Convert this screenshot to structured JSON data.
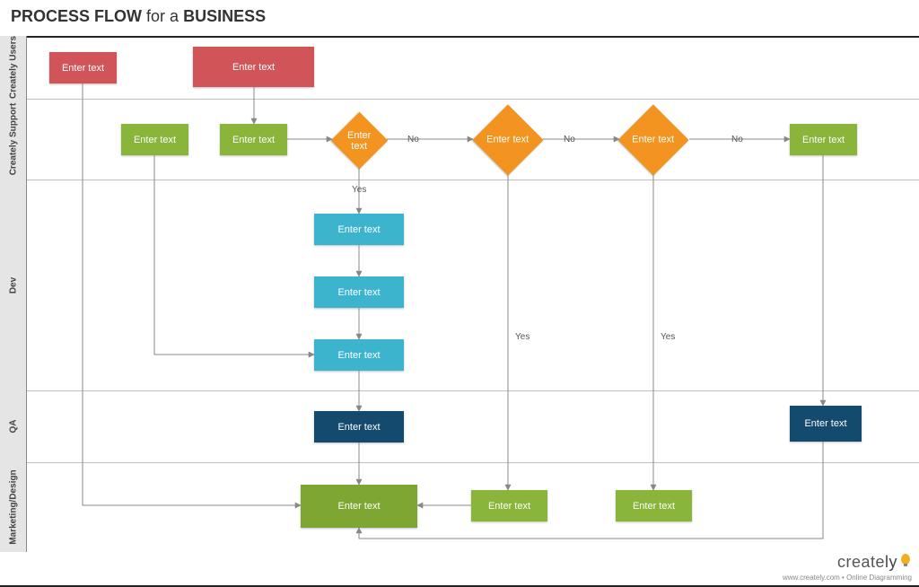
{
  "title": {
    "prefix": "PROCESS FLOW",
    "conj": "for a",
    "suffix": "BUSINESS"
  },
  "lanes": {
    "users": "Creately Users",
    "support": "Creately Support",
    "dev": "Dev",
    "qa": "QA",
    "marketing": "Marketing/Design"
  },
  "placeholders": {
    "text": "Enter text"
  },
  "labels": {
    "yes": "Yes",
    "no": "No"
  },
  "footer": {
    "brand_a": "create",
    "brand_b": "ly",
    "sub": "www.creately.com • Online Diagramming"
  },
  "colors": {
    "red": "#d05458",
    "green": "#89b53b",
    "green_dark": "#7ea632",
    "orange": "#f2941f",
    "teal": "#3cb4cd",
    "navy": "#134a6e"
  },
  "chart_data": {
    "type": "swimlane-flowchart",
    "title": "PROCESS FLOW for a BUSINESS",
    "lanes": [
      "Creately Users",
      "Creately Support",
      "Dev",
      "QA",
      "Marketing/Design"
    ],
    "nodes": [
      {
        "id": "u1",
        "lane": "Creately Users",
        "shape": "rect",
        "text": "Enter text",
        "color": "#d05458"
      },
      {
        "id": "u2",
        "lane": "Creately Users",
        "shape": "rect",
        "text": "Enter text",
        "color": "#d05458"
      },
      {
        "id": "s1",
        "lane": "Creately Support",
        "shape": "rect",
        "text": "Enter text",
        "color": "#89b53b"
      },
      {
        "id": "s2",
        "lane": "Creately Support",
        "shape": "rect",
        "text": "Enter text",
        "color": "#89b53b"
      },
      {
        "id": "d1",
        "lane": "Creately Support",
        "shape": "diamond",
        "text": "Enter text",
        "color": "#f2941f"
      },
      {
        "id": "d2",
        "lane": "Creately Support",
        "shape": "diamond",
        "text": "Enter text",
        "color": "#f2941f"
      },
      {
        "id": "d3",
        "lane": "Creately Support",
        "shape": "diamond",
        "text": "Enter text",
        "color": "#f2941f"
      },
      {
        "id": "s3",
        "lane": "Creately Support",
        "shape": "rect",
        "text": "Enter text",
        "color": "#89b53b"
      },
      {
        "id": "dev1",
        "lane": "Dev",
        "shape": "rect",
        "text": "Enter text",
        "color": "#3cb4cd"
      },
      {
        "id": "dev2",
        "lane": "Dev",
        "shape": "rect",
        "text": "Enter text",
        "color": "#3cb4cd"
      },
      {
        "id": "dev3",
        "lane": "Dev",
        "shape": "rect",
        "text": "Enter text",
        "color": "#3cb4cd"
      },
      {
        "id": "q1",
        "lane": "QA",
        "shape": "rect",
        "text": "Enter text",
        "color": "#134a6e"
      },
      {
        "id": "q2",
        "lane": "QA",
        "shape": "rect",
        "text": "Enter text",
        "color": "#134a6e"
      },
      {
        "id": "m1",
        "lane": "Marketing/Design",
        "shape": "rect",
        "text": "Enter text",
        "color": "#7ea632"
      },
      {
        "id": "m2",
        "lane": "Marketing/Design",
        "shape": "rect",
        "text": "Enter text",
        "color": "#89b53b"
      },
      {
        "id": "m3",
        "lane": "Marketing/Design",
        "shape": "rect",
        "text": "Enter text",
        "color": "#89b53b"
      }
    ],
    "edges": [
      {
        "from": "u2",
        "to": "s2"
      },
      {
        "from": "s2",
        "to": "d1"
      },
      {
        "from": "d1",
        "to": "d2",
        "label": "No"
      },
      {
        "from": "d2",
        "to": "d3",
        "label": "No"
      },
      {
        "from": "d3",
        "to": "s3",
        "label": "No"
      },
      {
        "from": "d1",
        "to": "dev1",
        "label": "Yes"
      },
      {
        "from": "dev1",
        "to": "dev2"
      },
      {
        "from": "dev2",
        "to": "dev3"
      },
      {
        "from": "s1",
        "to": "dev3"
      },
      {
        "from": "u1",
        "to": "m1"
      },
      {
        "from": "dev3",
        "to": "q1"
      },
      {
        "from": "q1",
        "to": "m1"
      },
      {
        "from": "d2",
        "to": "m2",
        "label": "Yes"
      },
      {
        "from": "d3",
        "to": "m3",
        "label": "Yes"
      },
      {
        "from": "m2",
        "to": "m1"
      },
      {
        "from": "s3",
        "to": "q2"
      },
      {
        "from": "q2",
        "to": "m1"
      }
    ]
  }
}
